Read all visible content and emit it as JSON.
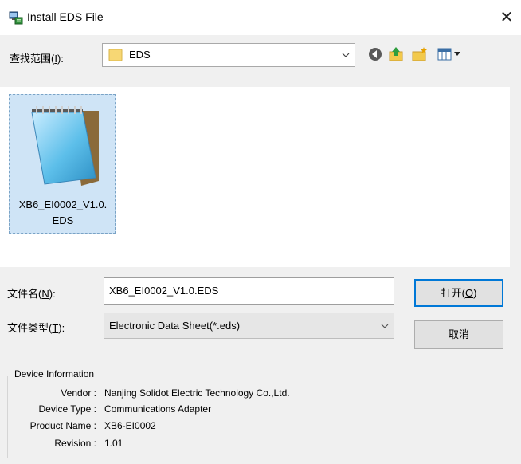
{
  "window": {
    "title": "Install EDS File",
    "close_glyph": "✕"
  },
  "lookin": {
    "label_prefix": "查找范围(",
    "label_key": "I",
    "label_suffix": "):",
    "value": "EDS"
  },
  "files": [
    {
      "name": "XB6_EI0002_V1.0.EDS",
      "name_line1": "XB6_EI0002_V1.0.",
      "name_line2": "EDS",
      "icon": "notepad-icon"
    }
  ],
  "filename": {
    "label_prefix": "文件名(",
    "label_key": "N",
    "label_suffix": "):",
    "value": "XB6_EI0002_V1.0.EDS"
  },
  "filetype": {
    "label_prefix": "文件类型(",
    "label_key": "T",
    "label_suffix": "):",
    "value": "Electronic Data Sheet(*.eds)"
  },
  "buttons": {
    "open_prefix": "打开(",
    "open_key": "O",
    "open_suffix": ")",
    "cancel": "取消"
  },
  "device_info": {
    "title": "Device Information",
    "rows": [
      {
        "label": "Vendor :",
        "value": "Nanjing Solidot Electric Technology Co.,Ltd."
      },
      {
        "label": "Device Type :",
        "value": "Communications Adapter"
      },
      {
        "label": "Product Name :",
        "value": "XB6-EI0002"
      },
      {
        "label": "Revision :",
        "value": "1.01"
      }
    ]
  },
  "colors": {
    "selection": "#cfe4f6",
    "default_button_border": "#0078d7",
    "folder": "#f7d774"
  }
}
